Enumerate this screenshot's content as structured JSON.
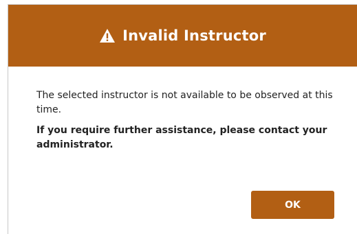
{
  "dialog": {
    "title": "Invalid Instructor",
    "title_icon": "warning-triangle-icon",
    "message": "The selected instructor is not available to be observed at this time.",
    "help_text": "If you require further assistance, please contact your administrator.",
    "ok_label": "OK"
  },
  "colors": {
    "header_bg": "#b25f14",
    "button_bg": "#b25f14",
    "header_text": "#ffffff"
  }
}
